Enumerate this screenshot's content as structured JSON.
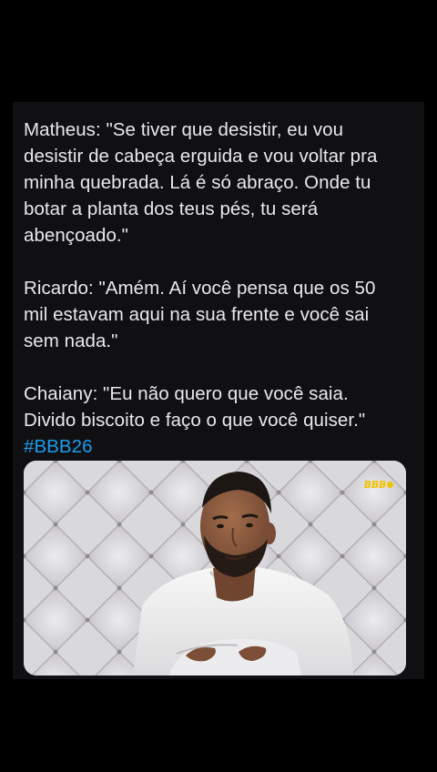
{
  "tweet": {
    "paragraph_1": {
      "line_1": "Matheus: \"Se tiver que desistir, eu vou",
      "line_2": "desistir de cabeça erguida e vou voltar pra",
      "line_3": "minha quebrada. Lá é só abraço. Onde tu",
      "line_4": "botar a planta dos teus pés, tu será",
      "line_5": "abençoado.\""
    },
    "paragraph_2": {
      "line_1": "Ricardo: \"Amém. Aí você pensa que os 50",
      "line_2": "mil estavam aqui na sua frente e você sai",
      "line_3": "sem nada.\""
    },
    "paragraph_3": {
      "line_1": "Chaiany: \"Eu não quero que você saia.",
      "line_2": "Divido biscoito e faço o que você quiser.\""
    },
    "hashtag": "#BBB26"
  },
  "media": {
    "logo_text": "BBB",
    "colors": {
      "wall": "#d6d5d8",
      "shirt": "#f1f1f1",
      "skin": "#8a5a3e",
      "hair": "#1c1714",
      "logo": "#f2c200"
    }
  },
  "colors": {
    "background": "#000000",
    "card": "#101012",
    "text": "#e7e9ea",
    "link": "#1d9bf0"
  }
}
